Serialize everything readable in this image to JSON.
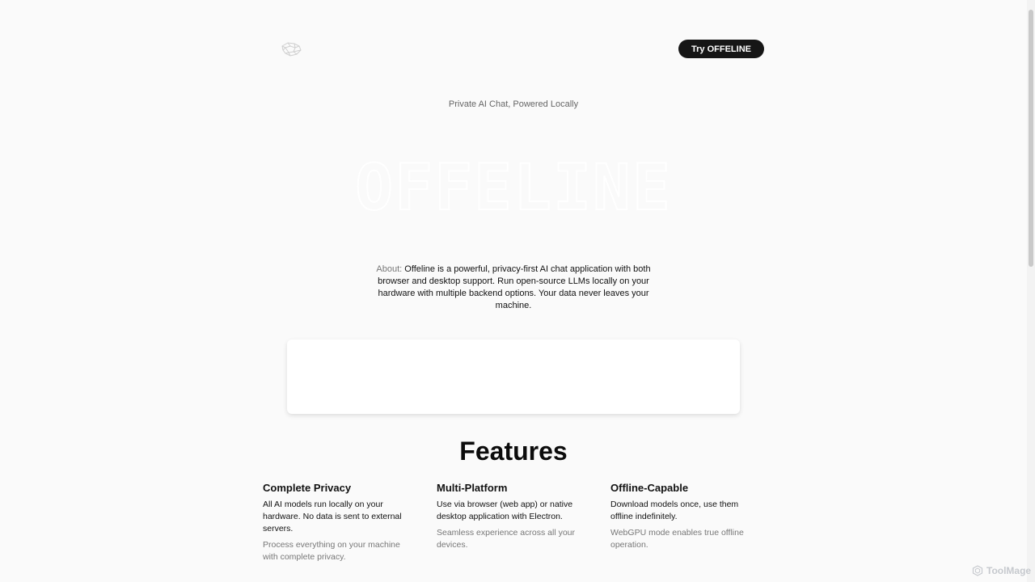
{
  "nav": {
    "cta_label": "Try OFFELINE"
  },
  "hero": {
    "tagline": "Private AI Chat, Powered Locally",
    "wordmark": "OFFELINE"
  },
  "about": {
    "label": "About:",
    "text": "Offeline is a powerful, privacy-first AI chat application with both browser and desktop support. Run open-source LLMs locally on your hardware with multiple backend options. Your data never leaves your machine."
  },
  "features": {
    "title": "Features",
    "items": [
      {
        "title": "Complete Privacy",
        "description": "All AI models run locally on your hardware. No data is sent to external servers.",
        "detail": "Process everything on your machine with complete privacy."
      },
      {
        "title": "Multi-Platform",
        "description": "Use via browser (web app) or native desktop application with Electron.",
        "detail": "Seamless experience across all your devices."
      },
      {
        "title": "Offline-Capable",
        "description": "Download models once, use them offline indefinitely.",
        "detail": "WebGPU mode enables true offline operation."
      }
    ]
  },
  "watermark": {
    "text": "ToolMage"
  },
  "icons": {
    "logo": "offeline-logo",
    "watermark": "toolmage-logo-icon"
  },
  "colors": {
    "background": "#fafafa",
    "cta_background": "#161616",
    "cta_text": "#ffffff",
    "muted_text": "#777777"
  }
}
